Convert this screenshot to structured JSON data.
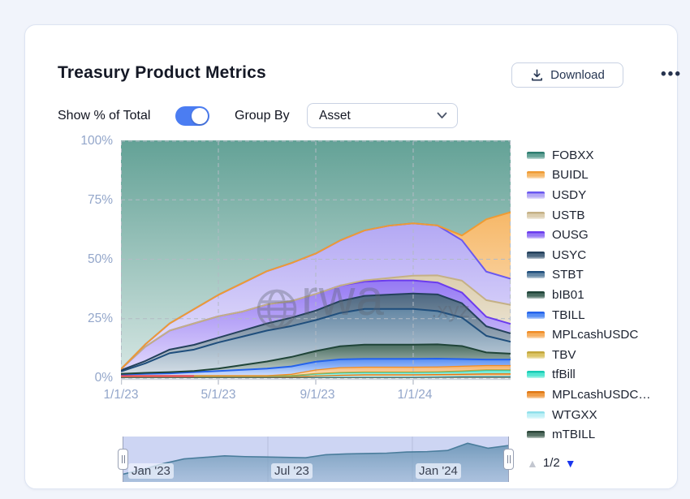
{
  "header": {
    "title": "Treasury Product Metrics",
    "download_label": "Download",
    "more_options_icon": "•••"
  },
  "controls": {
    "toggle_label": "Show % of Total",
    "toggle_on": true,
    "group_by_label": "Group By",
    "group_by_value": "Asset"
  },
  "watermark": {
    "text_main": "rwa",
    "text_suffix": ".xyz"
  },
  "legend_pagination": {
    "page": "1/2",
    "prev_icon": "▲",
    "next_icon": "▼"
  },
  "chart_data": {
    "type": "area",
    "stacking": "percent",
    "title": "Treasury Product Metrics",
    "grid": true,
    "legend_position": "right",
    "x_monthly": [
      "2023-01",
      "2023-02",
      "2023-03",
      "2023-04",
      "2023-05",
      "2023-06",
      "2023-07",
      "2023-08",
      "2023-09",
      "2023-10",
      "2023-11",
      "2023-12",
      "2024-01",
      "2024-02",
      "2024-03",
      "2024-04",
      "2024-05"
    ],
    "x_axis": {
      "tick_labels": [
        "1/1/23",
        "5/1/23",
        "9/1/23",
        "1/1/24"
      ],
      "range": [
        "2023-01-01",
        "2024-05-01"
      ]
    },
    "y_axis": {
      "tick_labels": [
        "100%",
        "75%",
        "50%",
        "25%",
        "0%"
      ],
      "min": 0,
      "max": 100,
      "unit": "%"
    },
    "series": [
      {
        "name": "FOBXX",
        "color": "#4E9588",
        "line_color": "#2E7D70",
        "values": [
          96.2,
          85.8,
          77.0,
          71.0,
          65.0,
          60.0,
          55.0,
          51.6,
          47.6,
          42.1,
          37.9,
          35.9,
          34.9,
          35.8,
          40.0,
          33.2,
          30.2
        ]
      },
      {
        "name": "BUIDL",
        "color": "#F5AE53",
        "line_color": "#EF9B33",
        "values": [
          0,
          0,
          0,
          0,
          0,
          0,
          0,
          0,
          0,
          0,
          0,
          0,
          0,
          0,
          2.0,
          22,
          28
        ]
      },
      {
        "name": "USDY",
        "color": "#A99CF2",
        "line_color": "#6A58F0",
        "values": [
          0,
          1.0,
          3.0,
          6.0,
          9.0,
          12,
          14,
          16,
          17,
          19,
          21,
          22,
          22,
          21,
          17,
          12,
          11
        ]
      },
      {
        "name": "USTB",
        "color": "#D7C7A4",
        "line_color": "#C4B085",
        "values": [
          0,
          0,
          0,
          0,
          0,
          0,
          0,
          0,
          0,
          0,
          0.5,
          1.0,
          2.0,
          3.0,
          5.0,
          7.0,
          8.0
        ]
      },
      {
        "name": "OUSG",
        "color": "#8666F2",
        "line_color": "#6B3BEE",
        "values": [
          0.5,
          6.0,
          8.0,
          9.0,
          9.0,
          8.0,
          8.0,
          7.0,
          7.0,
          6.5,
          6.0,
          6.0,
          5.5,
          5.0,
          4.5,
          4.0,
          4.0
        ]
      },
      {
        "name": "USYC",
        "color": "#33526F",
        "line_color": "#24415C",
        "values": [
          0.5,
          1.0,
          1.5,
          2.0,
          2.0,
          2.5,
          3.0,
          3.5,
          4.0,
          5.0,
          5.5,
          6.0,
          6.5,
          7.0,
          6.0,
          4.0,
          3.5
        ]
      },
      {
        "name": "STBT",
        "color": "#4E7697",
        "line_color": "#1F4E7C",
        "values": [
          1.0,
          4.0,
          8.0,
          9.0,
          11,
          12,
          13,
          13,
          13,
          14,
          15,
          15,
          15,
          14,
          12,
          7.0,
          5.0
        ]
      },
      {
        "name": "bIB01",
        "color": "#30584A",
        "line_color": "#1F4438",
        "values": [
          0.3,
          0.4,
          0.5,
          0.5,
          1.0,
          2.0,
          3.0,
          4.0,
          4.5,
          5.5,
          6.0,
          6.0,
          6.0,
          6.0,
          5.5,
          3.0,
          2.5
        ]
      },
      {
        "name": "TBILL",
        "color": "#3E7EF2",
        "line_color": "#2563EB",
        "values": [
          0.5,
          0.8,
          1.0,
          1.5,
          2.0,
          2.5,
          3.0,
          3.3,
          3.5,
          3.5,
          3.5,
          3.5,
          3.5,
          3.5,
          3.0,
          2.5,
          2.5
        ]
      },
      {
        "name": "MPLcashUSDC",
        "color": "#F5A44A",
        "line_color": "#F08C26",
        "values": [
          0,
          0,
          0,
          0,
          0,
          0,
          0,
          0.5,
          1.5,
          2.0,
          2.0,
          2.0,
          2.0,
          2.0,
          2.0,
          1.8,
          1.8
        ]
      },
      {
        "name": "TBV",
        "color": "#D6BC52",
        "line_color": "#C2A63C",
        "values": [
          0.2,
          0.2,
          0.2,
          0.2,
          0.2,
          0.2,
          0.2,
          0.2,
          0.2,
          0.2,
          0.2,
          0.2,
          0.2,
          0.2,
          0.2,
          0.2,
          0.2
        ]
      },
      {
        "name": "tfBill",
        "color": "#3BE2CB",
        "line_color": "#17CBB4",
        "values": [
          0.2,
          0.2,
          0.2,
          0.2,
          0.2,
          0.2,
          0.2,
          0.3,
          0.8,
          1.0,
          1.0,
          1.0,
          1.0,
          1.0,
          1.2,
          1.5,
          1.5
        ]
      },
      {
        "name": "MPLcashUSDC…",
        "color": "#EE8E2C",
        "line_color": "#E07714",
        "values": [
          0,
          0,
          0,
          0,
          0,
          0,
          0,
          0,
          0.3,
          0.6,
          0.8,
          0.8,
          0.8,
          0.8,
          0.8,
          1.0,
          1.0
        ]
      },
      {
        "name": "WTGXX",
        "color": "#B5EEF5",
        "line_color": "#8FDFEA",
        "values": [
          0.3,
          0.3,
          0.3,
          0.3,
          0.3,
          0.3,
          0.3,
          0.3,
          0.3,
          0.3,
          0.3,
          0.3,
          0.3,
          0.3,
          0.3,
          0.3,
          0.3
        ]
      },
      {
        "name": "mTBILL",
        "color": "#3C5B4C",
        "line_color": "#2C463A",
        "values": [
          0.3,
          0.3,
          0.3,
          0.3,
          0.3,
          0.3,
          0.3,
          0.3,
          0.3,
          0.3,
          0.3,
          0.3,
          0.3,
          0.4,
          0.5,
          0.5,
          0.5
        ]
      }
    ],
    "unlabeled_bottom_line": {
      "color": "#E8485C",
      "note": "thin series line near 0% in early 2023",
      "x_span_months": [
        0,
        3
      ]
    },
    "navigator": {
      "labels": [
        "Jan '23",
        "Jul '23",
        "Jan '24"
      ],
      "values_relative": [
        12,
        25,
        40,
        52,
        56,
        60,
        58,
        57,
        56,
        55,
        63,
        65,
        66,
        67,
        70,
        71,
        74,
        93,
        80,
        87
      ]
    }
  }
}
